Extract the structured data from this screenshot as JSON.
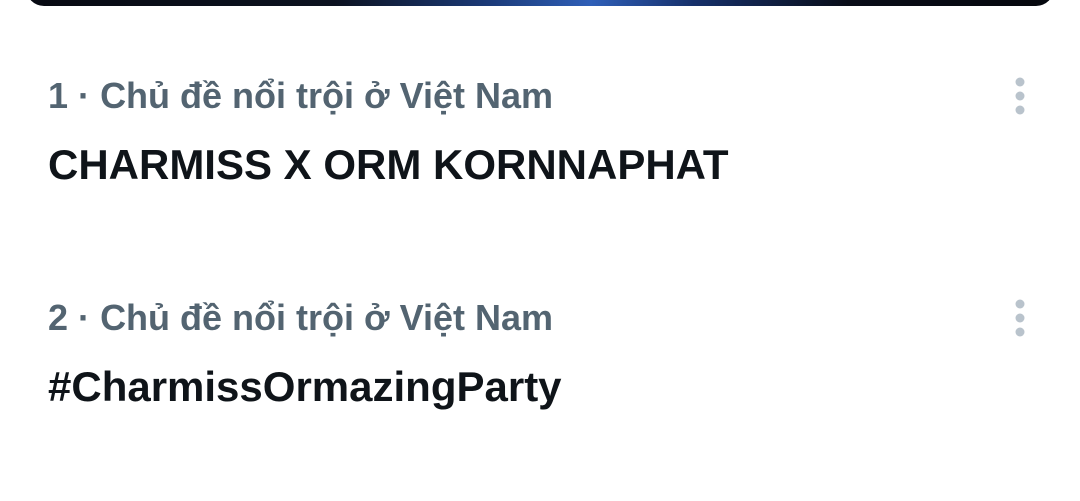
{
  "trends": [
    {
      "rank": "1",
      "separator": "·",
      "context": "Chủ đề nổi trội ở Việt Nam",
      "title": "CHARMISS X ORM KORNNAPHAT",
      "more_icon": "more-vertical-icon"
    },
    {
      "rank": "2",
      "separator": "·",
      "context": "Chủ đề nổi trội ở Việt Nam",
      "title": "#CharmissOrmazingParty",
      "more_icon": "more-vertical-icon"
    }
  ],
  "colors": {
    "secondary_text": "#536471",
    "primary_text": "#0f1419",
    "icon": "#b9c3cc"
  }
}
